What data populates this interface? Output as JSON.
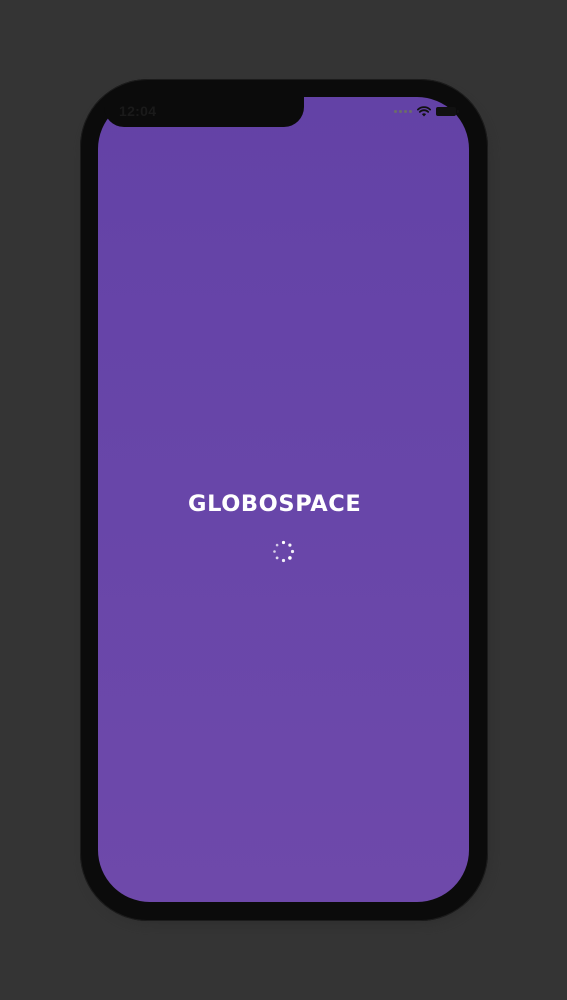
{
  "status_bar": {
    "time": "12:04",
    "wifi_icon": "wifi-icon",
    "battery_icon": "battery-icon"
  },
  "splash": {
    "logo_text": "GLOBOSPACE",
    "loading_indicator": "spinner-icon"
  },
  "colors": {
    "background": "#343434",
    "phone_frame": "#0b0b0b",
    "screen_top": "#6342a6",
    "screen_bottom": "#6e49aa",
    "logo": "#ffffff"
  }
}
